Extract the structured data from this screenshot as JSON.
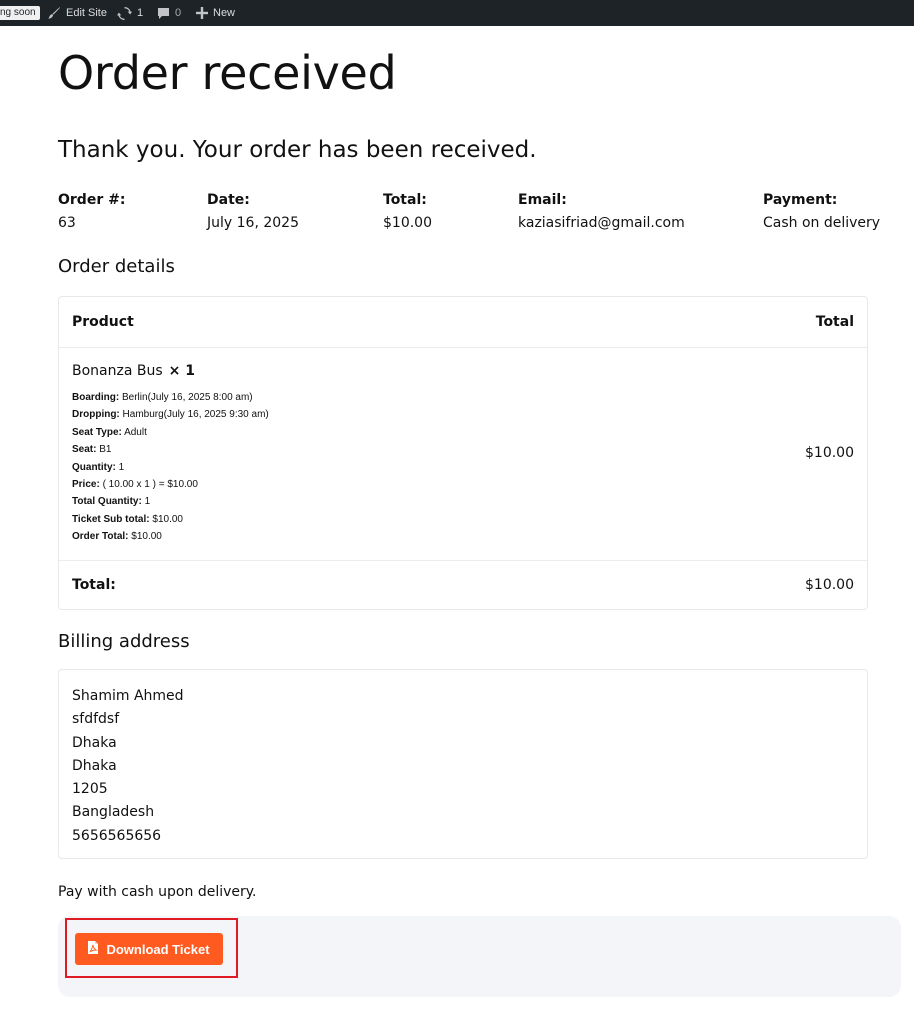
{
  "adminbar": {
    "coming_soon": "ng soon",
    "edit_site": "Edit Site",
    "updates_count": "1",
    "comments_count": "0",
    "new_label": "New"
  },
  "page": {
    "title": "Order received",
    "thank_you": "Thank you. Your order has been received."
  },
  "overview": {
    "order_label": "Order #:",
    "order_value": "63",
    "date_label": "Date:",
    "date_value": "July 16, 2025",
    "total_label": "Total:",
    "total_value": "$10.00",
    "email_label": "Email:",
    "email_value": "kaziasifriad@gmail.com",
    "payment_label": "Payment:",
    "payment_value": "Cash on delivery"
  },
  "order_details": {
    "heading": "Order details",
    "col_product": "Product",
    "col_total": "Total",
    "item": {
      "name": "Bonanza Bus",
      "qty": "× 1",
      "line_total": "$10.00",
      "meta": [
        {
          "label": "Boarding:",
          "value": "Berlin(July 16, 2025 8:00 am)"
        },
        {
          "label": "Dropping:",
          "value": "Hamburg(July 16, 2025 9:30 am)"
        },
        {
          "label": "Seat Type:",
          "value": "Adult"
        },
        {
          "label": "Seat:",
          "value": "B1"
        },
        {
          "label": "Quantity:",
          "value": "1"
        },
        {
          "label": "Price:",
          "value": "( 10.00 x 1 ) = $10.00"
        },
        {
          "label": "Total Quantity:",
          "value": "1"
        },
        {
          "label": "Ticket Sub total:",
          "value": "$10.00"
        },
        {
          "label": "Order Total:",
          "value": "$10.00"
        }
      ]
    },
    "footer_label": "Total:",
    "footer_value": "$10.00"
  },
  "billing": {
    "heading": "Billing address",
    "lines": [
      "Shamim Ahmed",
      "sfdfdsf",
      "Dhaka",
      "Dhaka",
      "1205",
      "Bangladesh",
      "5656565656"
    ]
  },
  "payment_note": "Pay with cash upon delivery.",
  "download": {
    "label": "Download Ticket",
    "button_color": "#ff5a1f",
    "icon": "pdf-file-icon"
  }
}
